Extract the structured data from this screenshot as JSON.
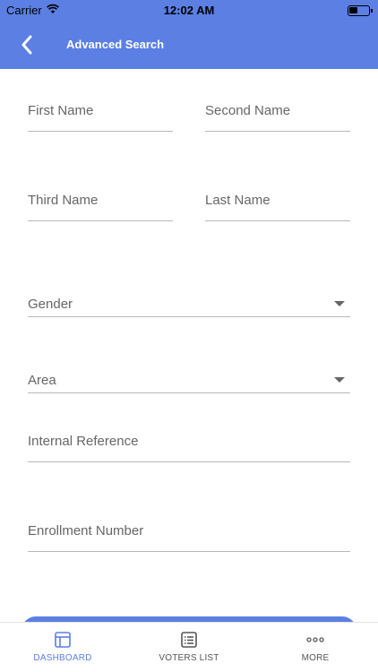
{
  "status_bar": {
    "carrier": "Carrier",
    "time": "12:02 AM"
  },
  "nav": {
    "title": "Advanced Search",
    "back_icon": "chevron-left-icon"
  },
  "form": {
    "first_name": "First Name",
    "second_name": "Second Name",
    "third_name": "Third Name",
    "last_name": "Last Name",
    "gender": "Gender",
    "area": "Area",
    "internal_reference": "Internal Reference",
    "enrollment_number": "Enrollment Number"
  },
  "tabs": [
    {
      "label": "DASHBOARD",
      "icon": "dashboard-icon",
      "active": true
    },
    {
      "label": "VOTERS LIST",
      "icon": "list-icon",
      "active": false
    },
    {
      "label": "MORE",
      "icon": "more-icon",
      "active": false
    }
  ],
  "colors": {
    "primary": "#5b7fe3",
    "tab_active": "#5b7fe3",
    "divider": "#b8b8b8"
  }
}
